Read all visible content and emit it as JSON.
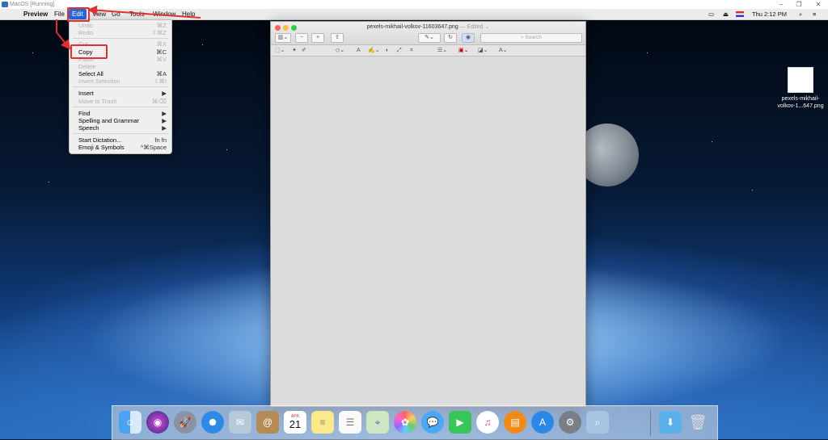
{
  "host_window": {
    "title": "MacOS [Running]"
  },
  "menubar": {
    "apple_icon": "apple-icon",
    "app_name": "Preview",
    "items": [
      "File",
      "Edit",
      "View",
      "Go",
      "Tools",
      "Window",
      "Help"
    ],
    "active_item": "Edit",
    "clock": "Thu 2:12 PM"
  },
  "edit_menu": {
    "items": [
      {
        "label": "Undo",
        "shortcut": "⌘Z",
        "enabled": false
      },
      {
        "label": "Redo",
        "shortcut": "⇧⌘Z",
        "enabled": false
      },
      {
        "label": "Cut",
        "shortcut": "⌘X",
        "enabled": false
      },
      {
        "label": "Copy",
        "shortcut": "⌘C",
        "enabled": true
      },
      {
        "label": "Paste",
        "shortcut": "⌘V",
        "enabled": false
      },
      {
        "label": "Delete",
        "shortcut": "",
        "enabled": false
      },
      {
        "label": "Select All",
        "shortcut": "⌘A",
        "enabled": true
      },
      {
        "label": "Invert Selection",
        "shortcut": "⇧⌘I",
        "enabled": false
      },
      {
        "label": "Insert",
        "shortcut": "▶",
        "enabled": true
      },
      {
        "label": "Move to Trash",
        "shortcut": "⌘⌫",
        "enabled": false
      },
      {
        "label": "Find",
        "shortcut": "▶",
        "enabled": true
      },
      {
        "label": "Spelling and Grammar",
        "shortcut": "▶",
        "enabled": true
      },
      {
        "label": "Speech",
        "shortcut": "▶",
        "enabled": true
      },
      {
        "label": "Start Dictation...",
        "shortcut": "fn fn",
        "enabled": true
      },
      {
        "label": "Emoji & Symbols",
        "shortcut": "^⌘Space",
        "enabled": true
      }
    ]
  },
  "preview_window": {
    "filename": "pexels-mikhail-volkov-11603647.png",
    "status": "— Edited ⌄",
    "search_placeholder": "Search"
  },
  "desktop": {
    "file_name_line1": "pexels-mikhail-",
    "file_name_line2": "volkov-1...647.png"
  },
  "dock": {
    "calendar_month": "APR",
    "calendar_day": "21",
    "apps": [
      "Finder",
      "Siri",
      "Launchpad",
      "Safari",
      "Mail",
      "Contacts",
      "Calendar",
      "Notes",
      "Reminders",
      "Maps",
      "Photos",
      "Messages",
      "FaceTime",
      "iTunes",
      "iBooks",
      "App Store",
      "System Preferences",
      "Preview",
      "Downloads",
      "Trash"
    ]
  },
  "colors": {
    "annotation_red": "#e03030",
    "menu_highlight": "#2b68d6"
  }
}
